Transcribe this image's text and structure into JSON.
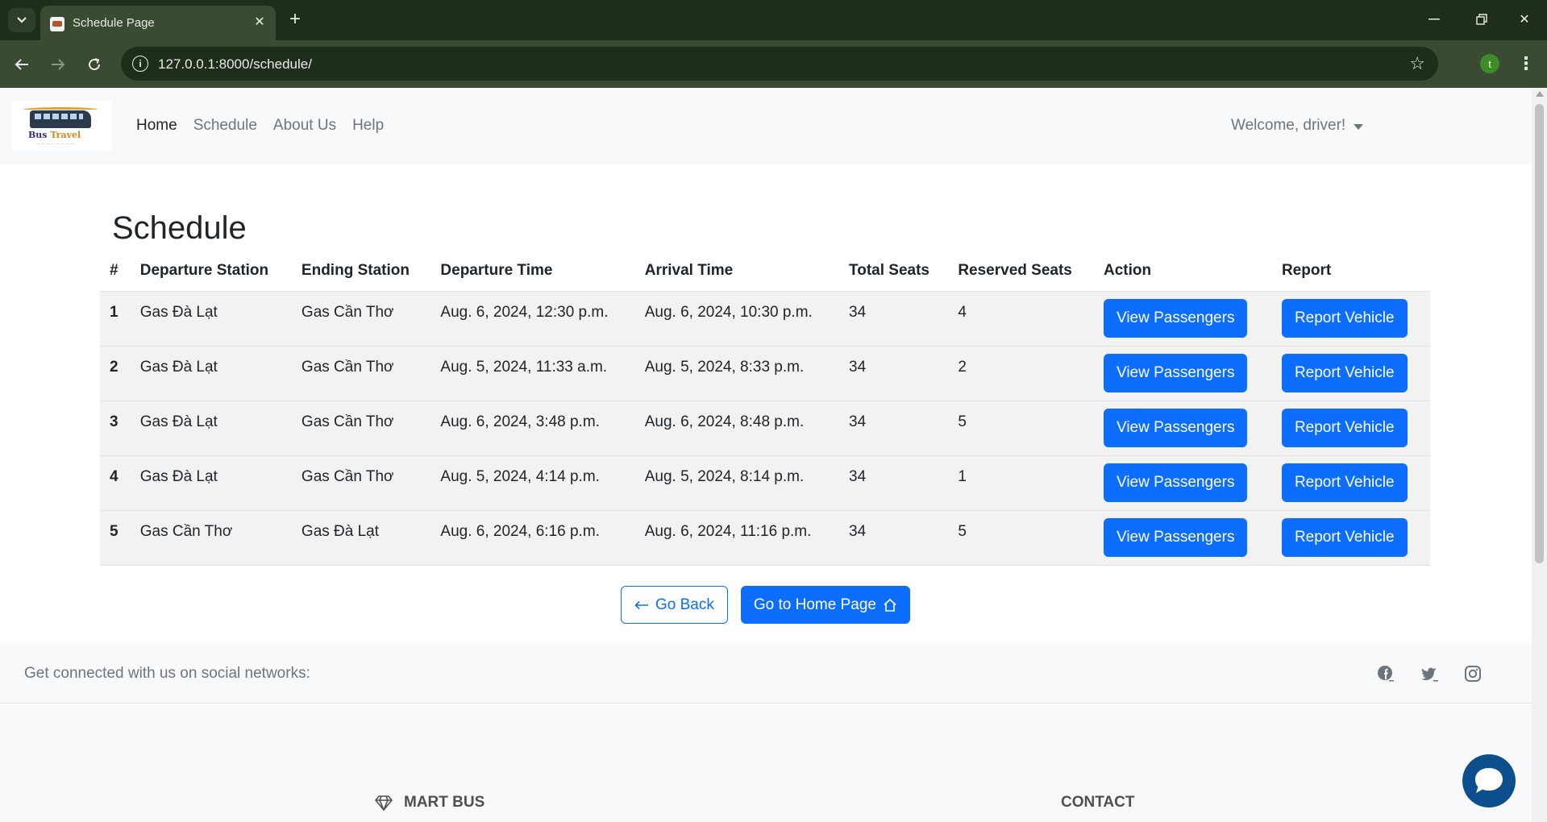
{
  "browser": {
    "tab_title": "Schedule Page",
    "url": "127.0.0.1:8000/schedule/",
    "profile_initial": "t"
  },
  "nav": {
    "links": [
      "Home",
      "Schedule",
      "About Us",
      "Help"
    ],
    "welcome": "Welcome, driver!",
    "logo_text_1": "Bus",
    "logo_text_2": "Travel"
  },
  "page": {
    "title": "Schedule"
  },
  "table": {
    "headers": [
      "#",
      "Departure Station",
      "Ending Station",
      "Departure Time",
      "Arrival Time",
      "Total Seats",
      "Reserved Seats",
      "Action",
      "Report"
    ],
    "rows": [
      {
        "num": "1",
        "departure": "Gas Đà Lạt",
        "ending": "Gas Cần Thơ",
        "dep_time": "Aug. 6, 2024, 12:30 p.m.",
        "arr_time": "Aug. 6, 2024, 10:30 p.m.",
        "total": "34",
        "reserved": "4"
      },
      {
        "num": "2",
        "departure": "Gas Đà Lạt",
        "ending": "Gas Cần Thơ",
        "dep_time": "Aug. 5, 2024, 11:33 a.m.",
        "arr_time": "Aug. 5, 2024, 8:33 p.m.",
        "total": "34",
        "reserved": "2"
      },
      {
        "num": "3",
        "departure": "Gas Đà Lạt",
        "ending": "Gas Cần Thơ",
        "dep_time": "Aug. 6, 2024, 3:48 p.m.",
        "arr_time": "Aug. 6, 2024, 8:48 p.m.",
        "total": "34",
        "reserved": "5"
      },
      {
        "num": "4",
        "departure": "Gas Đà Lạt",
        "ending": "Gas Cần Thơ",
        "dep_time": "Aug. 5, 2024, 4:14 p.m.",
        "arr_time": "Aug. 5, 2024, 8:14 p.m.",
        "total": "34",
        "reserved": "1"
      },
      {
        "num": "5",
        "departure": "Gas Cần Thơ",
        "ending": "Gas Đà Lạt",
        "dep_time": "Aug. 6, 2024, 6:16 p.m.",
        "arr_time": "Aug. 6, 2024, 11:16 p.m.",
        "total": "34",
        "reserved": "5"
      }
    ],
    "view_label": "View Passengers",
    "report_label": "Report Vehicle"
  },
  "actions": {
    "back_label": "Go Back",
    "home_label": "Go to Home Page"
  },
  "footer": {
    "social_text": "Get connected with us on social networks:",
    "social_icons": [
      "facebook-icon",
      "twitter-icon",
      "instagram-icon"
    ],
    "col1_heading": "MART BUS",
    "col2_heading": "CONTACT"
  },
  "colors": {
    "primary": "#0d6efd",
    "browser_frame": "#1f2d1b",
    "chat_bubble": "#0d4e8c"
  }
}
